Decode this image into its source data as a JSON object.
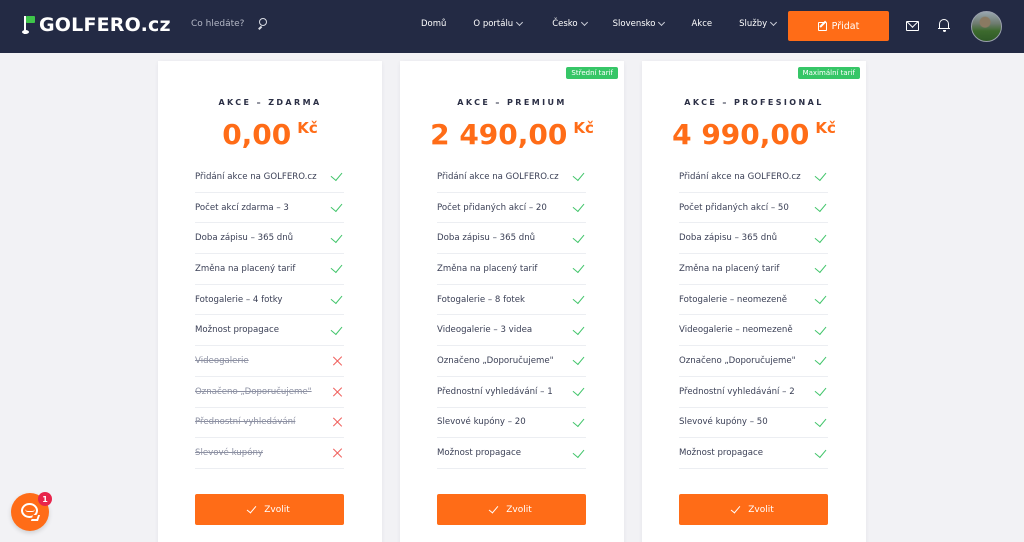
{
  "header": {
    "logo_text": "GOLFERO.cz",
    "search": {
      "placeholder": "Co hledáte?"
    },
    "nav": [
      {
        "label": "Domů",
        "has_dropdown": false
      },
      {
        "label": "O portálu",
        "has_dropdown": true
      },
      {
        "label": "Česko",
        "has_dropdown": true
      },
      {
        "label": "Slovensko",
        "has_dropdown": true
      },
      {
        "label": "Akce",
        "has_dropdown": false
      },
      {
        "label": "Služby",
        "has_dropdown": true
      }
    ],
    "add_button_label": "Přidat",
    "icons": [
      "flag-logo-icon",
      "search-icon",
      "edit-icon",
      "mail-icon",
      "bell-icon",
      "avatar"
    ]
  },
  "plans": [
    {
      "name": "AKCE – ZDARMA",
      "badge": "",
      "price": "0,00",
      "currency": "Kč",
      "features": [
        {
          "text": "Přidání akce na GOLFERO.cz",
          "included": true
        },
        {
          "text": "Počet akcí zdarma – 3",
          "included": true
        },
        {
          "text": "Doba zápisu – 365 dnů",
          "included": true
        },
        {
          "text": "Změna na placený tarif",
          "included": true
        },
        {
          "text": "Fotogalerie – 4 fotky",
          "included": true
        },
        {
          "text": "Možnost propagace",
          "included": true
        },
        {
          "text": "Videogalerie",
          "included": false
        },
        {
          "text": "Označeno „Doporučujeme\"",
          "included": false
        },
        {
          "text": "Přednostní vyhledávání",
          "included": false
        },
        {
          "text": "Slevové kupóny",
          "included": false
        }
      ],
      "button_label": "Zvolit"
    },
    {
      "name": "AKCE – PREMIUM",
      "badge": "Střední tarif",
      "price": "2 490,00",
      "currency": "Kč",
      "features": [
        {
          "text": "Přidání akce na GOLFERO.cz",
          "included": true
        },
        {
          "text": "Počet přidaných akcí – 20",
          "included": true
        },
        {
          "text": "Doba zápisu – 365 dnů",
          "included": true
        },
        {
          "text": "Změna na placený tarif",
          "included": true
        },
        {
          "text": "Fotogalerie – 8 fotek",
          "included": true
        },
        {
          "text": "Videogalerie – 3 videa",
          "included": true
        },
        {
          "text": "Označeno „Doporučujeme\"",
          "included": true
        },
        {
          "text": "Přednostní vyhledávání – 1",
          "included": true
        },
        {
          "text": "Slevové kupóny – 20",
          "included": true
        },
        {
          "text": "Možnost propagace",
          "included": true
        }
      ],
      "button_label": "Zvolit"
    },
    {
      "name": "AKCE – PROFESIONAL",
      "badge": "Maximální tarif",
      "price": "4 990,00",
      "currency": "Kč",
      "features": [
        {
          "text": "Přidání akce na GOLFERO.cz",
          "included": true
        },
        {
          "text": "Počet přidaných akcí – 50",
          "included": true
        },
        {
          "text": "Doba zápisu – 365 dnů",
          "included": true
        },
        {
          "text": "Změna na placený tarif",
          "included": true
        },
        {
          "text": "Fotogalerie – neomezeně",
          "included": true
        },
        {
          "text": "Videogalerie – neomezeně",
          "included": true
        },
        {
          "text": "Označeno „Doporučujeme\"",
          "included": true
        },
        {
          "text": "Přednostní vyhledávání – 2",
          "included": true
        },
        {
          "text": "Slevové kupóny – 50",
          "included": true
        },
        {
          "text": "Možnost propagace",
          "included": true
        }
      ],
      "button_label": "Zvolit"
    }
  ],
  "chat": {
    "unread_count": "1"
  },
  "colors": {
    "header_bg": "#232a44",
    "accent": "#ff6c17",
    "badge_green": "#36c667",
    "check_green": "#42c56b",
    "cross_red": "#f0605d",
    "chat_badge": "#e8254b"
  }
}
